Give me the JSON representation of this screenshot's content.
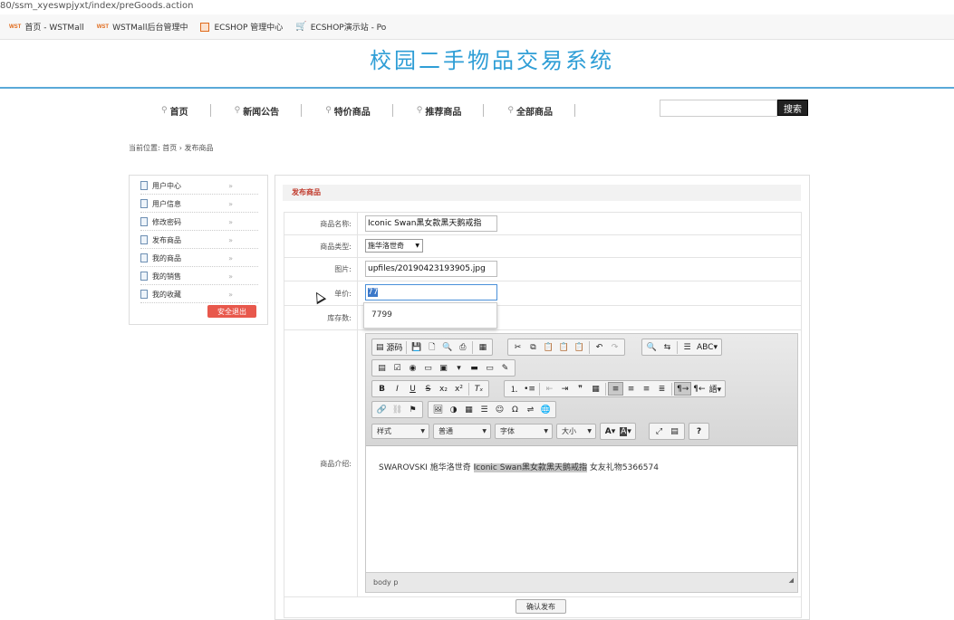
{
  "browser": {
    "url": "80/ssm_xyeswpjyxt/index/preGoods.action",
    "bookmarks": [
      {
        "icon": "WST",
        "label": "首页 - WSTMall"
      },
      {
        "icon": "WST",
        "label": "WSTMall后台管理中"
      },
      {
        "icon": "box-icon",
        "label": "ECSHOP 管理中心"
      },
      {
        "icon": "cart-icon",
        "label": "ECSHOP演示站 - Po"
      }
    ]
  },
  "header": {
    "logo": "校园二手物品交易系统"
  },
  "nav": {
    "items": [
      "首页",
      "新闻公告",
      "特价商品",
      "推荐商品",
      "全部商品"
    ],
    "search_placeholder": "",
    "search_button": "搜索"
  },
  "breadcrumb": "当前位置: 首页 › 发布商品",
  "sidebar": {
    "items": [
      "用户中心",
      "用户信息",
      "修改密码",
      "发布商品",
      "我的商品",
      "我的销售",
      "我的收藏"
    ],
    "logout": "安全退出"
  },
  "panel": {
    "title": "发布商品",
    "fields": {
      "name_label": "商品名称:",
      "name_value": "Iconic Swan黑女款黑天鹅戒指",
      "type_label": "商品类型:",
      "type_value": "施华洛世奇",
      "image_label": "图片:",
      "image_value": "upfiles/20190423193905.jpg",
      "price_label": "单价:",
      "price_value": "77",
      "stock_label": "库存数:",
      "desc_label": "商品介绍:"
    },
    "autocomplete_option": "7799",
    "editor": {
      "source_button": "源码",
      "combos": [
        "样式",
        "普通",
        "字体",
        "大小"
      ],
      "content_before": "SWAROVSKI 施华洛世奇 ",
      "content_highlight": "Iconic Swan黑女款黑天鹅戒指",
      "content_after": " 女友礼物5366574",
      "status_path": "body  p"
    },
    "submit": "确认发布"
  }
}
